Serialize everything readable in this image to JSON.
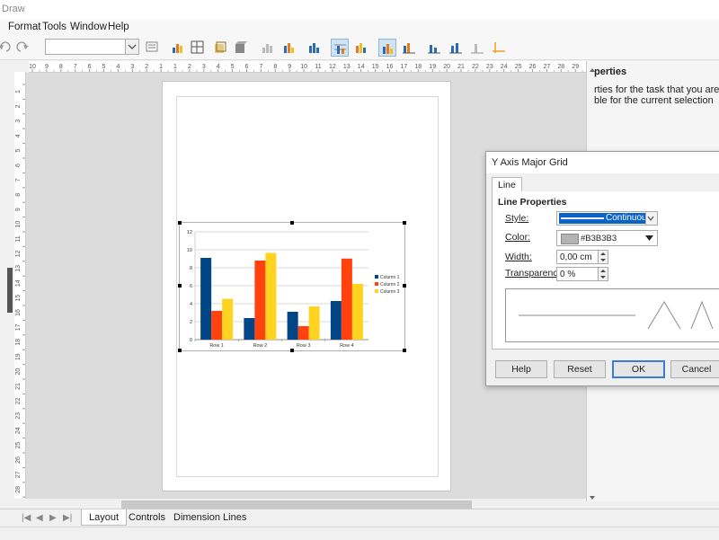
{
  "window": {
    "title": "Draw"
  },
  "menu": [
    "Format",
    "Tools",
    "Window",
    "Help"
  ],
  "tabs": [
    "Layout",
    "Controls",
    "Dimension Lines"
  ],
  "hruler_labels": [
    "10",
    "9",
    "8",
    "7",
    "6",
    "5",
    "4",
    "3",
    "2",
    "1",
    "1",
    "2",
    "3",
    "4",
    "5",
    "6",
    "7",
    "8",
    "9",
    "10",
    "11",
    "12",
    "13",
    "14",
    "15",
    "16",
    "17",
    "18",
    "19",
    "20",
    "21",
    "22",
    "23",
    "24",
    "25",
    "26",
    "27",
    "28",
    "29"
  ],
  "vruler_labels": [
    "1",
    "2",
    "3",
    "4",
    "5",
    "6",
    "7",
    "8",
    "9",
    "10",
    "11",
    "12",
    "13",
    "14",
    "15",
    "16",
    "17",
    "18",
    "19",
    "20",
    "21",
    "22",
    "23",
    "24",
    "25",
    "26",
    "27",
    "28",
    "29"
  ],
  "sidebar": {
    "title": "perties",
    "text_line1": "rties for the task that you are perfor",
    "text_line2": "ble for the current selection"
  },
  "dialog": {
    "title": "Y Axis Major Grid",
    "tab": "Line",
    "section": "Line Properties",
    "style_label": "Style:",
    "style_value": "Continuou",
    "color_label": "Color:",
    "color_value": "#B3B3B3",
    "color_swatch": "#B3B3B3",
    "width_label": "Width:",
    "width_value": "0,00 cm",
    "transparency_label": "Transparency:",
    "transparency_value": "0 %",
    "buttons": {
      "help": "Help",
      "reset": "Reset",
      "ok": "OK",
      "cancel": "Cancel"
    }
  },
  "colors": {
    "accent": "#3a7bd5",
    "series1": "#004586",
    "series2": "#ff420e",
    "series3": "#ffd320"
  },
  "chart_data": {
    "type": "bar",
    "categories": [
      "Row 1",
      "Row 2",
      "Row 3",
      "Row 4"
    ],
    "series": [
      {
        "name": "Column 1",
        "values": [
          9.1,
          2.4,
          3.1,
          4.3
        ]
      },
      {
        "name": "Column 2",
        "values": [
          3.2,
          8.8,
          1.5,
          9.02
        ]
      },
      {
        "name": "Column 3",
        "values": [
          4.54,
          9.65,
          3.7,
          6.2
        ]
      }
    ],
    "yticks": [
      "0",
      "2",
      "4",
      "6",
      "8",
      "10",
      "12"
    ],
    "ylim": [
      0,
      12
    ],
    "grid": true,
    "legend": "right"
  }
}
